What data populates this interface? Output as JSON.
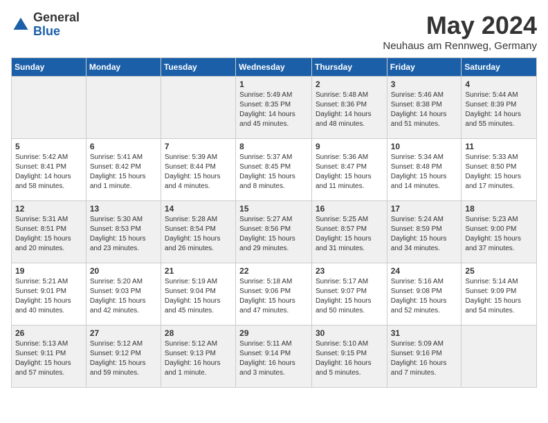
{
  "logo": {
    "general": "General",
    "blue": "Blue"
  },
  "title": "May 2024",
  "location": "Neuhaus am Rennweg, Germany",
  "weekdays": [
    "Sunday",
    "Monday",
    "Tuesday",
    "Wednesday",
    "Thursday",
    "Friday",
    "Saturday"
  ],
  "weeks": [
    {
      "days": [
        {
          "num": "",
          "content": ""
        },
        {
          "num": "",
          "content": ""
        },
        {
          "num": "",
          "content": ""
        },
        {
          "num": "1",
          "content": "Sunrise: 5:49 AM\nSunset: 8:35 PM\nDaylight: 14 hours\nand 45 minutes."
        },
        {
          "num": "2",
          "content": "Sunrise: 5:48 AM\nSunset: 8:36 PM\nDaylight: 14 hours\nand 48 minutes."
        },
        {
          "num": "3",
          "content": "Sunrise: 5:46 AM\nSunset: 8:38 PM\nDaylight: 14 hours\nand 51 minutes."
        },
        {
          "num": "4",
          "content": "Sunrise: 5:44 AM\nSunset: 8:39 PM\nDaylight: 14 hours\nand 55 minutes."
        }
      ]
    },
    {
      "days": [
        {
          "num": "5",
          "content": "Sunrise: 5:42 AM\nSunset: 8:41 PM\nDaylight: 14 hours\nand 58 minutes."
        },
        {
          "num": "6",
          "content": "Sunrise: 5:41 AM\nSunset: 8:42 PM\nDaylight: 15 hours\nand 1 minute."
        },
        {
          "num": "7",
          "content": "Sunrise: 5:39 AM\nSunset: 8:44 PM\nDaylight: 15 hours\nand 4 minutes."
        },
        {
          "num": "8",
          "content": "Sunrise: 5:37 AM\nSunset: 8:45 PM\nDaylight: 15 hours\nand 8 minutes."
        },
        {
          "num": "9",
          "content": "Sunrise: 5:36 AM\nSunset: 8:47 PM\nDaylight: 15 hours\nand 11 minutes."
        },
        {
          "num": "10",
          "content": "Sunrise: 5:34 AM\nSunset: 8:48 PM\nDaylight: 15 hours\nand 14 minutes."
        },
        {
          "num": "11",
          "content": "Sunrise: 5:33 AM\nSunset: 8:50 PM\nDaylight: 15 hours\nand 17 minutes."
        }
      ]
    },
    {
      "days": [
        {
          "num": "12",
          "content": "Sunrise: 5:31 AM\nSunset: 8:51 PM\nDaylight: 15 hours\nand 20 minutes."
        },
        {
          "num": "13",
          "content": "Sunrise: 5:30 AM\nSunset: 8:53 PM\nDaylight: 15 hours\nand 23 minutes."
        },
        {
          "num": "14",
          "content": "Sunrise: 5:28 AM\nSunset: 8:54 PM\nDaylight: 15 hours\nand 26 minutes."
        },
        {
          "num": "15",
          "content": "Sunrise: 5:27 AM\nSunset: 8:56 PM\nDaylight: 15 hours\nand 29 minutes."
        },
        {
          "num": "16",
          "content": "Sunrise: 5:25 AM\nSunset: 8:57 PM\nDaylight: 15 hours\nand 31 minutes."
        },
        {
          "num": "17",
          "content": "Sunrise: 5:24 AM\nSunset: 8:59 PM\nDaylight: 15 hours\nand 34 minutes."
        },
        {
          "num": "18",
          "content": "Sunrise: 5:23 AM\nSunset: 9:00 PM\nDaylight: 15 hours\nand 37 minutes."
        }
      ]
    },
    {
      "days": [
        {
          "num": "19",
          "content": "Sunrise: 5:21 AM\nSunset: 9:01 PM\nDaylight: 15 hours\nand 40 minutes."
        },
        {
          "num": "20",
          "content": "Sunrise: 5:20 AM\nSunset: 9:03 PM\nDaylight: 15 hours\nand 42 minutes."
        },
        {
          "num": "21",
          "content": "Sunrise: 5:19 AM\nSunset: 9:04 PM\nDaylight: 15 hours\nand 45 minutes."
        },
        {
          "num": "22",
          "content": "Sunrise: 5:18 AM\nSunset: 9:06 PM\nDaylight: 15 hours\nand 47 minutes."
        },
        {
          "num": "23",
          "content": "Sunrise: 5:17 AM\nSunset: 9:07 PM\nDaylight: 15 hours\nand 50 minutes."
        },
        {
          "num": "24",
          "content": "Sunrise: 5:16 AM\nSunset: 9:08 PM\nDaylight: 15 hours\nand 52 minutes."
        },
        {
          "num": "25",
          "content": "Sunrise: 5:14 AM\nSunset: 9:09 PM\nDaylight: 15 hours\nand 54 minutes."
        }
      ]
    },
    {
      "days": [
        {
          "num": "26",
          "content": "Sunrise: 5:13 AM\nSunset: 9:11 PM\nDaylight: 15 hours\nand 57 minutes."
        },
        {
          "num": "27",
          "content": "Sunrise: 5:12 AM\nSunset: 9:12 PM\nDaylight: 15 hours\nand 59 minutes."
        },
        {
          "num": "28",
          "content": "Sunrise: 5:12 AM\nSunset: 9:13 PM\nDaylight: 16 hours\nand 1 minute."
        },
        {
          "num": "29",
          "content": "Sunrise: 5:11 AM\nSunset: 9:14 PM\nDaylight: 16 hours\nand 3 minutes."
        },
        {
          "num": "30",
          "content": "Sunrise: 5:10 AM\nSunset: 9:15 PM\nDaylight: 16 hours\nand 5 minutes."
        },
        {
          "num": "31",
          "content": "Sunrise: 5:09 AM\nSunset: 9:16 PM\nDaylight: 16 hours\nand 7 minutes."
        },
        {
          "num": "",
          "content": ""
        }
      ]
    }
  ]
}
